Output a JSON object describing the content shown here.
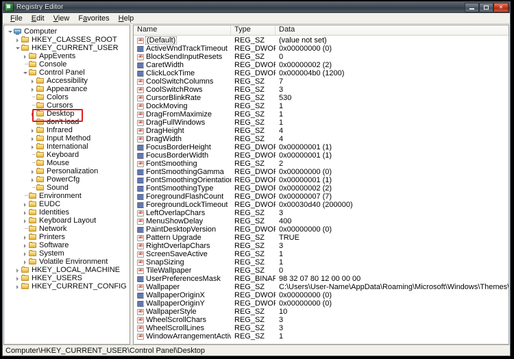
{
  "window": {
    "title": "Registry Editor",
    "app_icon": "registry-editor-icon",
    "controls": {
      "minimize": "minimize-button",
      "maximize": "maximize-button",
      "close": "close-button"
    }
  },
  "menu": {
    "items": [
      {
        "label": "File",
        "accel": "F"
      },
      {
        "label": "Edit",
        "accel": "E"
      },
      {
        "label": "View",
        "accel": "V"
      },
      {
        "label": "Favorites",
        "accel": "a"
      },
      {
        "label": "Help",
        "accel": "H"
      }
    ]
  },
  "tree": {
    "annotation_color": "#e01b1b",
    "annotated_node": "Desktop",
    "nodes": [
      {
        "label": "Computer",
        "depth": 0,
        "state": "open",
        "icon": "computer-icon"
      },
      {
        "label": "HKEY_CLASSES_ROOT",
        "depth": 1,
        "state": "closed",
        "icon": "folder-icon"
      },
      {
        "label": "HKEY_CURRENT_USER",
        "depth": 1,
        "state": "open",
        "icon": "folder-icon"
      },
      {
        "label": "AppEvents",
        "depth": 2,
        "state": "closed",
        "icon": "folder-icon"
      },
      {
        "label": "Console",
        "depth": 2,
        "state": "leaf",
        "icon": "folder-icon"
      },
      {
        "label": "Control Panel",
        "depth": 2,
        "state": "open",
        "icon": "folder-icon"
      },
      {
        "label": "Accessibility",
        "depth": 3,
        "state": "closed",
        "icon": "folder-icon"
      },
      {
        "label": "Appearance",
        "depth": 3,
        "state": "closed",
        "icon": "folder-icon"
      },
      {
        "label": "Colors",
        "depth": 3,
        "state": "leaf",
        "icon": "folder-icon"
      },
      {
        "label": "Cursors",
        "depth": 3,
        "state": "leaf",
        "icon": "folder-icon"
      },
      {
        "label": "Desktop",
        "depth": 3,
        "state": "closed",
        "icon": "folder-icon"
      },
      {
        "label": "don't load",
        "depth": 3,
        "state": "leaf",
        "icon": "folder-icon"
      },
      {
        "label": "Infrared",
        "depth": 3,
        "state": "closed",
        "icon": "folder-icon"
      },
      {
        "label": "Input Method",
        "depth": 3,
        "state": "closed",
        "icon": "folder-icon"
      },
      {
        "label": "International",
        "depth": 3,
        "state": "closed",
        "icon": "folder-icon"
      },
      {
        "label": "Keyboard",
        "depth": 3,
        "state": "leaf",
        "icon": "folder-icon"
      },
      {
        "label": "Mouse",
        "depth": 3,
        "state": "leaf",
        "icon": "folder-icon"
      },
      {
        "label": "Personalization",
        "depth": 3,
        "state": "closed",
        "icon": "folder-icon"
      },
      {
        "label": "PowerCfg",
        "depth": 3,
        "state": "closed",
        "icon": "folder-icon"
      },
      {
        "label": "Sound",
        "depth": 3,
        "state": "leaf",
        "icon": "folder-icon"
      },
      {
        "label": "Environment",
        "depth": 2,
        "state": "leaf",
        "icon": "folder-icon"
      },
      {
        "label": "EUDC",
        "depth": 2,
        "state": "closed",
        "icon": "folder-icon"
      },
      {
        "label": "Identities",
        "depth": 2,
        "state": "closed",
        "icon": "folder-icon"
      },
      {
        "label": "Keyboard Layout",
        "depth": 2,
        "state": "closed",
        "icon": "folder-icon"
      },
      {
        "label": "Network",
        "depth": 2,
        "state": "leaf",
        "icon": "folder-icon"
      },
      {
        "label": "Printers",
        "depth": 2,
        "state": "closed",
        "icon": "folder-icon"
      },
      {
        "label": "Software",
        "depth": 2,
        "state": "closed",
        "icon": "folder-icon"
      },
      {
        "label": "System",
        "depth": 2,
        "state": "closed",
        "icon": "folder-icon"
      },
      {
        "label": "Volatile Environment",
        "depth": 2,
        "state": "closed",
        "icon": "folder-icon"
      },
      {
        "label": "HKEY_LOCAL_MACHINE",
        "depth": 1,
        "state": "closed",
        "icon": "folder-icon"
      },
      {
        "label": "HKEY_USERS",
        "depth": 1,
        "state": "closed",
        "icon": "folder-icon"
      },
      {
        "label": "HKEY_CURRENT_CONFIG",
        "depth": 1,
        "state": "closed",
        "icon": "folder-icon"
      }
    ]
  },
  "list": {
    "columns": [
      "Name",
      "Type",
      "Data"
    ],
    "rows": [
      {
        "name": "(Default)",
        "type": "REG_SZ",
        "data": "(value not set)",
        "icon": "string-value-icon",
        "boxed": true
      },
      {
        "name": "ActiveWndTrackTimeout",
        "type": "REG_DWORD",
        "data": "0x00000000 (0)",
        "icon": "dword-value-icon"
      },
      {
        "name": "BlockSendInputResets",
        "type": "REG_SZ",
        "data": "0",
        "icon": "string-value-icon"
      },
      {
        "name": "CaretWidth",
        "type": "REG_DWORD",
        "data": "0x00000002 (2)",
        "icon": "dword-value-icon"
      },
      {
        "name": "ClickLockTime",
        "type": "REG_DWORD",
        "data": "0x000004b0 (1200)",
        "icon": "dword-value-icon"
      },
      {
        "name": "CoolSwitchColumns",
        "type": "REG_SZ",
        "data": "7",
        "icon": "string-value-icon"
      },
      {
        "name": "CoolSwitchRows",
        "type": "REG_SZ",
        "data": "3",
        "icon": "string-value-icon"
      },
      {
        "name": "CursorBlinkRate",
        "type": "REG_SZ",
        "data": "530",
        "icon": "string-value-icon"
      },
      {
        "name": "DockMoving",
        "type": "REG_SZ",
        "data": "1",
        "icon": "string-value-icon"
      },
      {
        "name": "DragFromMaximize",
        "type": "REG_SZ",
        "data": "1",
        "icon": "string-value-icon"
      },
      {
        "name": "DragFullWindows",
        "type": "REG_SZ",
        "data": "1",
        "icon": "string-value-icon"
      },
      {
        "name": "DragHeight",
        "type": "REG_SZ",
        "data": "4",
        "icon": "string-value-icon"
      },
      {
        "name": "DragWidth",
        "type": "REG_SZ",
        "data": "4",
        "icon": "string-value-icon"
      },
      {
        "name": "FocusBorderHeight",
        "type": "REG_DWORD",
        "data": "0x00000001 (1)",
        "icon": "dword-value-icon"
      },
      {
        "name": "FocusBorderWidth",
        "type": "REG_DWORD",
        "data": "0x00000001 (1)",
        "icon": "dword-value-icon"
      },
      {
        "name": "FontSmoothing",
        "type": "REG_SZ",
        "data": "2",
        "icon": "string-value-icon"
      },
      {
        "name": "FontSmoothingGamma",
        "type": "REG_DWORD",
        "data": "0x00000000 (0)",
        "icon": "dword-value-icon"
      },
      {
        "name": "FontSmoothingOrientation",
        "type": "REG_DWORD",
        "data": "0x00000001 (1)",
        "icon": "dword-value-icon"
      },
      {
        "name": "FontSmoothingType",
        "type": "REG_DWORD",
        "data": "0x00000002 (2)",
        "icon": "dword-value-icon"
      },
      {
        "name": "ForegroundFlashCount",
        "type": "REG_DWORD",
        "data": "0x00000007 (7)",
        "icon": "dword-value-icon"
      },
      {
        "name": "ForegroundLockTimeout",
        "type": "REG_DWORD",
        "data": "0x00030d40 (200000)",
        "icon": "dword-value-icon"
      },
      {
        "name": "LeftOverlapChars",
        "type": "REG_SZ",
        "data": "3",
        "icon": "string-value-icon"
      },
      {
        "name": "MenuShowDelay",
        "type": "REG_SZ",
        "data": "400",
        "icon": "string-value-icon"
      },
      {
        "name": "PaintDesktopVersion",
        "type": "REG_DWORD",
        "data": "0x00000000 (0)",
        "icon": "dword-value-icon"
      },
      {
        "name": "Pattern Upgrade",
        "type": "REG_SZ",
        "data": "TRUE",
        "icon": "string-value-icon"
      },
      {
        "name": "RightOverlapChars",
        "type": "REG_SZ",
        "data": "3",
        "icon": "string-value-icon"
      },
      {
        "name": "ScreenSaveActive",
        "type": "REG_SZ",
        "data": "1",
        "icon": "string-value-icon"
      },
      {
        "name": "SnapSizing",
        "type": "REG_SZ",
        "data": "1",
        "icon": "string-value-icon"
      },
      {
        "name": "TileWallpaper",
        "type": "REG_SZ",
        "data": "0",
        "icon": "string-value-icon"
      },
      {
        "name": "UserPreferencesMask",
        "type": "REG_BINARY",
        "data": "98 32 07 80 12 00 00 00",
        "icon": "binary-value-icon"
      },
      {
        "name": "Wallpaper",
        "type": "REG_SZ",
        "data": "C:\\Users\\User-Name\\AppData\\Roaming\\Microsoft\\Windows\\Themes\\TranscodedWallpaper.jpg",
        "icon": "string-value-icon"
      },
      {
        "name": "WallpaperOriginX",
        "type": "REG_DWORD",
        "data": "0x00000000 (0)",
        "icon": "dword-value-icon"
      },
      {
        "name": "WallpaperOriginY",
        "type": "REG_DWORD",
        "data": "0x00000000 (0)",
        "icon": "dword-value-icon"
      },
      {
        "name": "WallpaperStyle",
        "type": "REG_SZ",
        "data": "10",
        "icon": "string-value-icon"
      },
      {
        "name": "WheelScrollChars",
        "type": "REG_SZ",
        "data": "3",
        "icon": "string-value-icon"
      },
      {
        "name": "WheelScrollLines",
        "type": "REG_SZ",
        "data": "3",
        "icon": "string-value-icon"
      },
      {
        "name": "WindowArrangementActive",
        "type": "REG_SZ",
        "data": "1",
        "icon": "string-value-icon"
      }
    ]
  },
  "statusbar": {
    "path": "Computer\\HKEY_CURRENT_USER\\Control Panel\\Desktop"
  }
}
